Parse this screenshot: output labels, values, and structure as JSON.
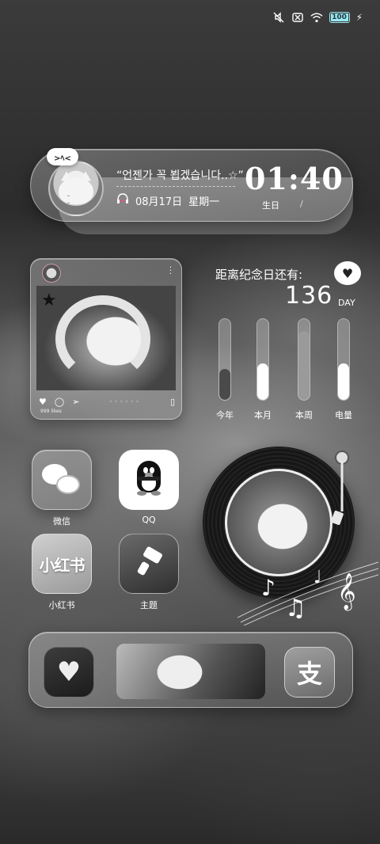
{
  "status_bar": {
    "icons": [
      "mute-icon",
      "no-sim-icon",
      "wifi-icon"
    ],
    "battery_level": "100",
    "charging": true,
    "battery_color": "#9be7ef"
  },
  "clock_widget": {
    "bubble_text": ">ﾍ<",
    "quote": "“언젠가 꼭 뵙겠습니다..☆”",
    "date": "08月17日",
    "weekday": "星期一",
    "time": "01:40",
    "subtitle": "生日",
    "separator": "/"
  },
  "photo_card": {
    "likes_text": "999 likes",
    "more_icon": "more-vertical-icon",
    "actions": [
      "heart-icon",
      "comment-icon",
      "send-icon",
      "bookmark-icon"
    ]
  },
  "countdown": {
    "title": "距离纪念日还有:",
    "days": "136",
    "unit": "DAY",
    "bars": [
      {
        "label": "今年",
        "fill": 0.38,
        "color": "#4a4a4a"
      },
      {
        "label": "本月",
        "fill": 0.45,
        "color": "#ffffff"
      },
      {
        "label": "本周",
        "fill": 0.85,
        "color": "#9a9a9a"
      },
      {
        "label": "电量",
        "fill": 0.45,
        "color": "#ffffff"
      }
    ]
  },
  "apps": [
    {
      "name": "微信",
      "icon": "wechat-icon"
    },
    {
      "name": "QQ",
      "icon": "qq-icon"
    },
    {
      "name": "小红书",
      "icon_text": "小红书",
      "icon": "xiaohongshu-icon"
    },
    {
      "name": "主题",
      "icon": "theme-icon"
    }
  ],
  "dock": {
    "left_icon": "heart-bow-icon",
    "right_icon_text": "支",
    "right_icon": "alipay-icon"
  }
}
